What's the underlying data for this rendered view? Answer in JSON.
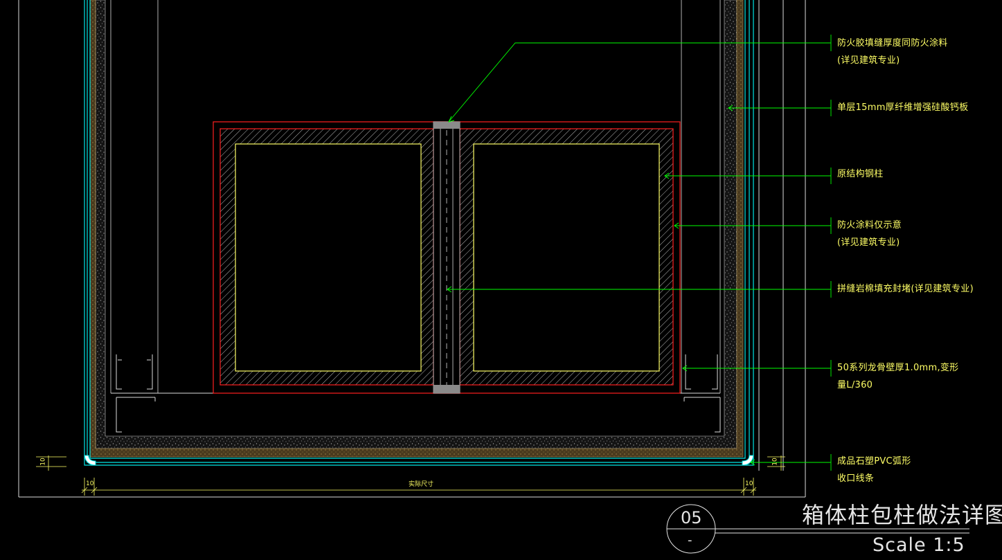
{
  "drawing": {
    "title": "箱体柱包柱做法详图",
    "scale": "Scale 1:5",
    "detail_number": "05",
    "sheet_ref": "-"
  },
  "annotations": [
    {
      "lines": [
        "防火胶填缝厚度同防火涂料",
        "(详见建筑专业)"
      ]
    },
    {
      "lines": [
        "单层15mm厚纤维增强硅酸钙板"
      ]
    },
    {
      "lines": [
        "原结构钢柱"
      ]
    },
    {
      "lines": [
        "防火涂料仅示意",
        "(详见建筑专业)"
      ]
    },
    {
      "lines": [
        "拼缝岩棉填充封堵(详见建筑专业)"
      ]
    },
    {
      "lines": [
        "50系列龙骨壁厚1.0mm,变形",
        "量L/360"
      ]
    },
    {
      "lines": [
        "成品石塑PVC弧形",
        "收口线条"
      ]
    }
  ],
  "dimensions": {
    "overall": "实际尺寸",
    "left_offset": "10",
    "right_offset": "10",
    "left_height": "10",
    "right_height": "10"
  },
  "colors": {
    "background": "#000000",
    "text": "#ffff66",
    "leader": "#00ff00",
    "fireproof_coating": "#ff2020",
    "steel_inner": "#ffff66",
    "cement_board": "#00ffff",
    "frame_lines": "#ffffff"
  }
}
